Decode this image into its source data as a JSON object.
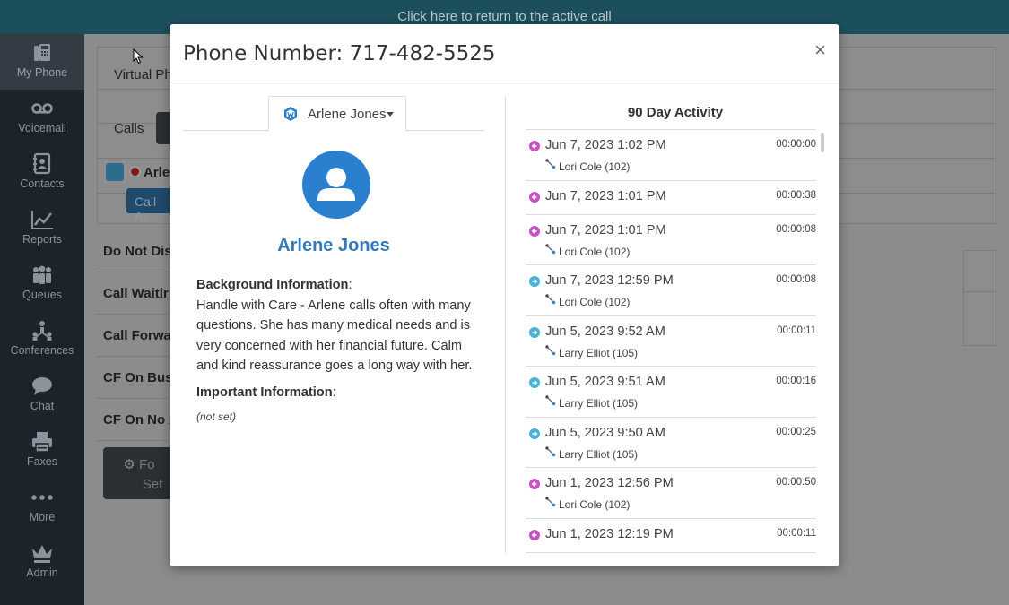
{
  "top_bar": {
    "text": "Click here to return to the active call"
  },
  "sidebar": {
    "items": [
      {
        "label": "My Phone",
        "icon": "phone-icon",
        "active": true
      },
      {
        "label": "Voicemail",
        "icon": "voicemail-icon"
      },
      {
        "label": "Contacts",
        "icon": "contacts-icon"
      },
      {
        "label": "Reports",
        "icon": "reports-icon"
      },
      {
        "label": "Queues",
        "icon": "queues-icon"
      },
      {
        "label": "Conferences",
        "icon": "conferences-icon"
      },
      {
        "label": "Chat",
        "icon": "chat-icon"
      },
      {
        "label": "Faxes",
        "icon": "fax-icon"
      },
      {
        "label": "More",
        "icon": "more-icon"
      },
      {
        "label": "Admin",
        "icon": "admin-icon"
      }
    ]
  },
  "background": {
    "virtual_phone": "Virtual Ph",
    "calls_tab": "Calls",
    "caller": "Arle",
    "call_action_btn": "Call Ac",
    "settings": [
      "Do Not Dis",
      "Call Waitir",
      "Call Forwa",
      "CF On Busy",
      "CF On No A"
    ],
    "forward_btn_line1": "Fo",
    "forward_btn_line2": "Set"
  },
  "modal": {
    "title": "Phone Number: 717-482-5525",
    "close": "×",
    "contact_tab_label": "Arlene Jones",
    "contact_name": "Arlene Jones",
    "background_info_label": "Background Information",
    "background_info_text": "Handle with Care - Arlene calls often with many questions. She has many medical needs and is very concerned with her financial future. Calm and kind reassurance goes a long way with her.",
    "important_info_label": "Important Information",
    "important_info_value": "(not set)",
    "activity_title": "90 Day Activity",
    "activity": [
      {
        "direction": "inbound",
        "date": "Jun 7, 2023 1:02 PM",
        "duration": "00:00:00",
        "agent": "Lori Cole (102)"
      },
      {
        "direction": "inbound",
        "date": "Jun 7, 2023 1:01 PM",
        "duration": "00:00:38",
        "agent": ""
      },
      {
        "direction": "inbound",
        "date": "Jun 7, 2023 1:01 PM",
        "duration": "00:00:08",
        "agent": "Lori Cole (102)"
      },
      {
        "direction": "outbound",
        "date": "Jun 7, 2023 12:59 PM",
        "duration": "00:00:08",
        "agent": "Lori Cole (102)"
      },
      {
        "direction": "outbound",
        "date": "Jun 5, 2023 9:52 AM",
        "duration": "00:00:11",
        "agent": "Larry Elliot (105)"
      },
      {
        "direction": "outbound",
        "date": "Jun 5, 2023 9:51 AM",
        "duration": "00:00:16",
        "agent": "Larry Elliot (105)"
      },
      {
        "direction": "outbound",
        "date": "Jun 5, 2023 9:50 AM",
        "duration": "00:00:25",
        "agent": "Larry Elliot (105)"
      },
      {
        "direction": "inbound",
        "date": "Jun 1, 2023 12:56 PM",
        "duration": "00:00:50",
        "agent": "Lori Cole (102)"
      },
      {
        "direction": "inbound",
        "date": "Jun 1, 2023 12:19 PM",
        "duration": "00:00:11",
        "agent": ""
      }
    ]
  },
  "colors": {
    "top_bar": "#1c4f5c",
    "sidebar": "#1b232b",
    "accent_blue": "#2a7fcf",
    "name_blue": "#3479b7",
    "inbound": "#c94fc5",
    "outbound": "#45b4dd"
  }
}
